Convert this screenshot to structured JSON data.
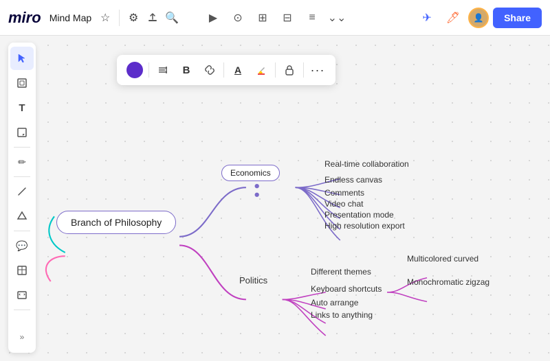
{
  "topbar": {
    "logo": "miro",
    "title": "Mind Map",
    "icons": {
      "star": "☆",
      "settings": "⚙",
      "upload": "⬆",
      "search": "🔍"
    },
    "center_icons": [
      "▶",
      "⊙",
      "⊞",
      "⊟",
      "≡",
      "⌄⌄"
    ],
    "right_icons": [
      "✈",
      "✏"
    ],
    "share_label": "Share"
  },
  "left_toolbar": {
    "items": [
      {
        "name": "cursor",
        "icon": "↖",
        "active": true
      },
      {
        "name": "frame",
        "icon": "⊡"
      },
      {
        "name": "text",
        "icon": "T"
      },
      {
        "name": "sticky",
        "icon": "◱"
      },
      {
        "name": "pen",
        "icon": "✏"
      },
      {
        "name": "line",
        "icon": "/"
      },
      {
        "name": "shape",
        "icon": "△"
      },
      {
        "name": "comment",
        "icon": "💬"
      },
      {
        "name": "table",
        "icon": "⊞"
      },
      {
        "name": "embed",
        "icon": "⊟"
      },
      {
        "name": "more",
        "icon": "»"
      }
    ]
  },
  "float_toolbar": {
    "circle_color": "#5c2dca",
    "items": [
      {
        "name": "color-dot",
        "icon": "●"
      },
      {
        "name": "align",
        "icon": "⊞≡"
      },
      {
        "name": "bold",
        "icon": "B"
      },
      {
        "name": "link",
        "icon": "🔗"
      },
      {
        "name": "underline",
        "icon": "A"
      },
      {
        "name": "highlight",
        "icon": "🖊"
      },
      {
        "name": "lock",
        "icon": "🔒"
      },
      {
        "name": "more",
        "icon": "···"
      }
    ]
  },
  "mindmap": {
    "root": "Branch of Philosophy",
    "branches": [
      {
        "label": "Economics",
        "children": [
          "Real-time collaboration",
          "Endless canvas",
          "Comments",
          "Video chat",
          "Presentation mode",
          "High resolution export"
        ]
      },
      {
        "label": "Politics",
        "children": [
          "Different themes",
          "Keyboard shortcuts",
          "Auto arrange",
          "Links to anything"
        ],
        "sub": {
          "parent": "Different themes",
          "children": [
            "Multicolored curved",
            "Monochromatic zigzag"
          ]
        }
      }
    ]
  }
}
